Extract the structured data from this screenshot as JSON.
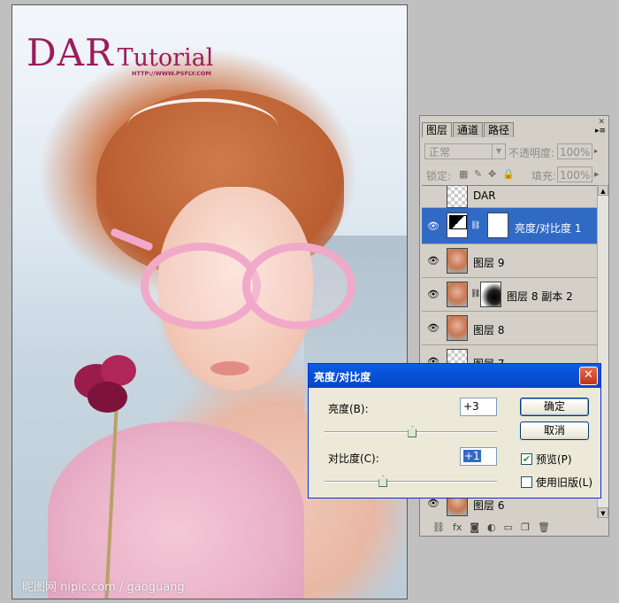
{
  "photo": {
    "brand_main": "DAR",
    "brand_sub": "Tutorial",
    "brand_url": "HTTP://WWW.PSFLY.COM",
    "watermark": "昵图网 nipic.com / gaoguang"
  },
  "layers_panel": {
    "tabs": [
      {
        "label": "图层",
        "active": true
      },
      {
        "label": "通道",
        "active": false
      },
      {
        "label": "路径",
        "active": false
      }
    ],
    "blend_mode": "正常",
    "opacity_label": "不透明度:",
    "opacity_value": "100%",
    "lock_label": "锁定:",
    "fill_label": "填充:",
    "fill_value": "100%",
    "layers": [
      {
        "name": "DAR",
        "type": "transparent"
      },
      {
        "name": "亮度/对比度 1",
        "type": "adjustment",
        "selected": true
      },
      {
        "name": "图层 9",
        "type": "photo"
      },
      {
        "name": "图层 8 副本 2",
        "type": "photo-mask"
      },
      {
        "name": "图层 8",
        "type": "photo"
      },
      {
        "name": "图层 7",
        "type": "transparent"
      },
      {
        "name": "图层 6",
        "type": "photo"
      }
    ]
  },
  "dialog": {
    "title": "亮度/对比度",
    "brightness_label": "亮度(B):",
    "brightness_value": "+3",
    "contrast_label": "对比度(C):",
    "contrast_value": "+1",
    "ok_label": "确定",
    "cancel_label": "取消",
    "preview_label": "预览(P)",
    "preview_checked": true,
    "legacy_label": "使用旧版(L)",
    "legacy_checked": false,
    "brightness_level": 3,
    "contrast_level": 1
  },
  "colors": {
    "brand": "#9b1c5c",
    "selection": "#316ac5",
    "titlebar": "#0853d9"
  }
}
